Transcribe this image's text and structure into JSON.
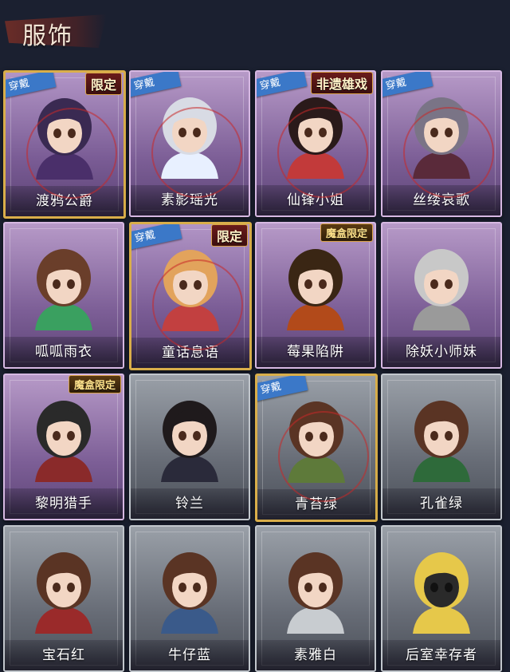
{
  "header": {
    "title": "服饰"
  },
  "labels": {
    "equipped": "穿戴",
    "limited": "限定",
    "heritage": "非遗雄戏",
    "box_limited": "魔盒限定"
  },
  "colors": {
    "background": "#1b2030",
    "purple_card": "#8f73a8",
    "gray_card": "#6b7079",
    "gold_border": "#d9ae4a",
    "equipped_tag": "#3b78c8"
  },
  "costumes": [
    {
      "name": "渡鸦公爵",
      "rarity": "gold",
      "equipped": true,
      "badge": "限定"
    },
    {
      "name": "素影瑶光",
      "rarity": "purple",
      "equipped": true,
      "badge": ""
    },
    {
      "name": "仙锋小姐",
      "rarity": "purple",
      "equipped": true,
      "badge": "非遗雄戏"
    },
    {
      "name": "丝缕哀歌",
      "rarity": "purple",
      "equipped": true,
      "badge": ""
    },
    {
      "name": "呱呱雨衣",
      "rarity": "purple",
      "equipped": false,
      "badge": ""
    },
    {
      "name": "童话息语",
      "rarity": "purple",
      "equipped": true,
      "badge": "限定"
    },
    {
      "name": "莓果陷阱",
      "rarity": "purple",
      "equipped": false,
      "badge": "魔盒限定"
    },
    {
      "name": "除妖小师妹",
      "rarity": "purple",
      "equipped": false,
      "badge": ""
    },
    {
      "name": "黎明猎手",
      "rarity": "purple",
      "equipped": false,
      "badge": "魔盒限定"
    },
    {
      "name": "铃兰",
      "rarity": "gray",
      "equipped": false,
      "badge": ""
    },
    {
      "name": "青苔绿",
      "rarity": "gray",
      "equipped": true,
      "badge": ""
    },
    {
      "name": "孔雀绿",
      "rarity": "gray",
      "equipped": false,
      "badge": ""
    },
    {
      "name": "宝石红",
      "rarity": "gray",
      "equipped": false,
      "badge": ""
    },
    {
      "name": "牛仔蓝",
      "rarity": "gray",
      "equipped": false,
      "badge": ""
    },
    {
      "name": "素雅白",
      "rarity": "gray",
      "equipped": false,
      "badge": ""
    },
    {
      "name": "后室幸存者",
      "rarity": "gray",
      "equipped": false,
      "badge": ""
    }
  ]
}
